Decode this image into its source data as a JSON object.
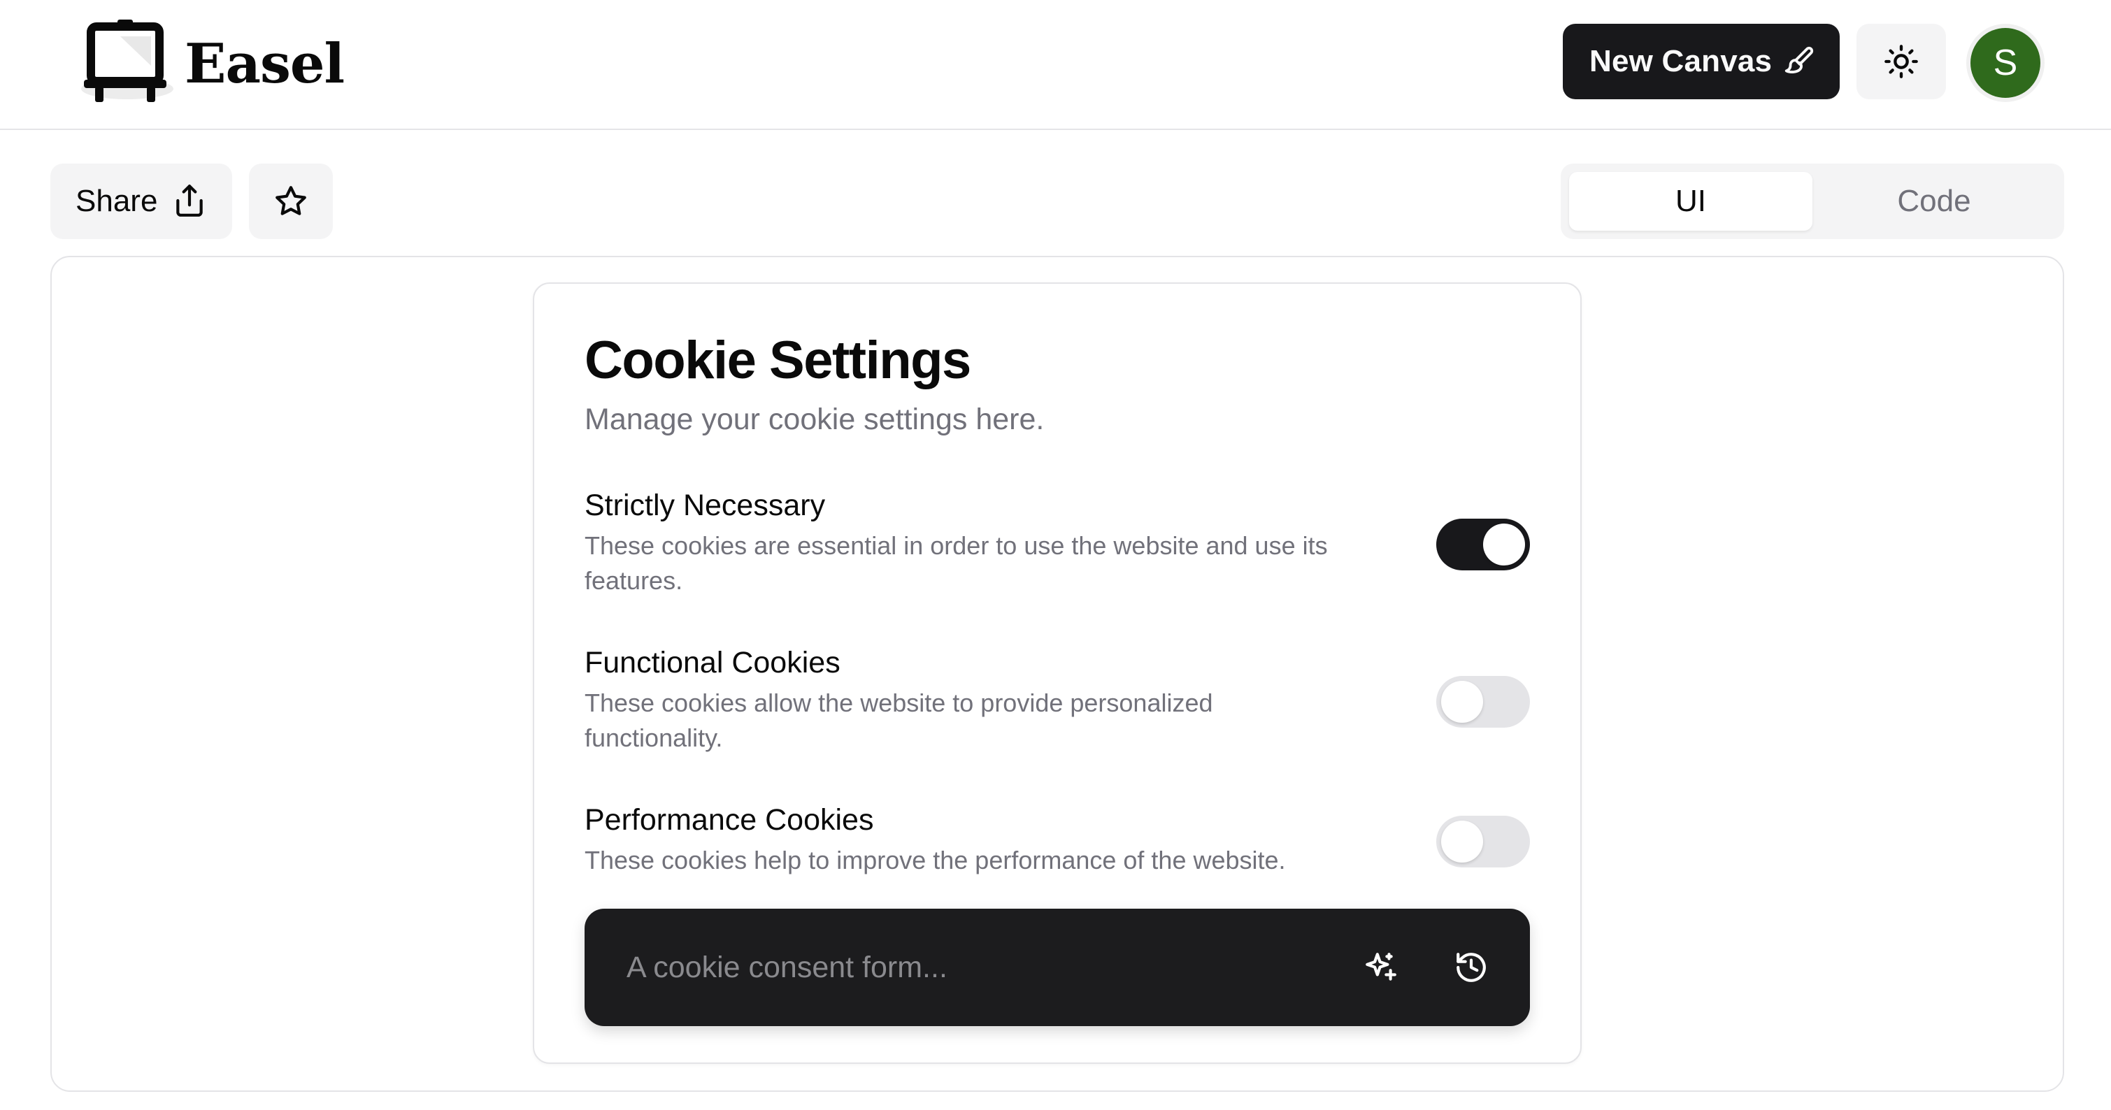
{
  "header": {
    "brand": "Easel",
    "new_canvas_label": "New Canvas",
    "avatar_initial": "S"
  },
  "toolbar": {
    "share_label": "Share",
    "view_tabs": [
      {
        "label": "UI",
        "active": true
      },
      {
        "label": "Code",
        "active": false
      }
    ]
  },
  "preview": {
    "title": "Cookie Settings",
    "subtitle": "Manage your cookie settings here.",
    "settings": [
      {
        "title": "Strictly Necessary",
        "description": "These cookies are essential in order to use the website and use its features.",
        "enabled": true
      },
      {
        "title": "Functional Cookies",
        "description": "These cookies allow the website to provide personalized functionality.",
        "enabled": false
      },
      {
        "title": "Performance Cookies",
        "description": "These cookies help to improve the performance of the website.",
        "enabled": false
      }
    ]
  },
  "prompt": {
    "placeholder": "A cookie consent form...",
    "value": ""
  },
  "icons": {
    "logo": "easel-icon",
    "new_canvas": "paintbrush-icon",
    "theme": "sun-icon",
    "share": "share-icon",
    "favorite": "star-icon",
    "generate": "sparkles-icon",
    "history": "history-icon"
  },
  "colors": {
    "primary": "#18181b",
    "avatar": "#2f6a1c",
    "muted_text": "#71717a",
    "switch_off": "#e4e4e7"
  }
}
